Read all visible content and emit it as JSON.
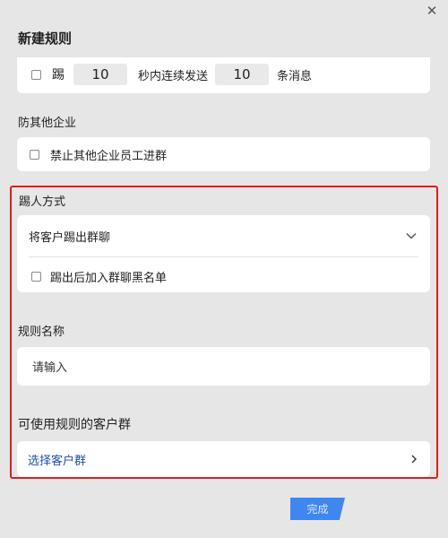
{
  "dialog": {
    "title": "新建规则",
    "close_glyph": "✕"
  },
  "spam_rule": {
    "kick_label": "踢",
    "seconds_value": "10",
    "middle_label": "秒内连续发送",
    "count_value": "10",
    "end_label": "条消息"
  },
  "block_other_company": {
    "section_title": "防其他企业",
    "option_label": "禁止其他企业员工进群"
  },
  "kick_method": {
    "section_title": "踢人方式",
    "selected": "将客户踢出群聊",
    "blacklist_label": "踢出后加入群聊黑名单"
  },
  "rule_name": {
    "section_title": "规则名称",
    "placeholder": "请输入"
  },
  "customer_groups": {
    "section_title": "可使用规则的客户群",
    "select_label": "选择客户群"
  },
  "footer": {
    "done_label": "完成"
  },
  "colors": {
    "background": "#e6e6e6",
    "highlight_border": "#e01e1e",
    "link_blue": "#1f4fa8",
    "primary_button": "#3f86f0"
  }
}
